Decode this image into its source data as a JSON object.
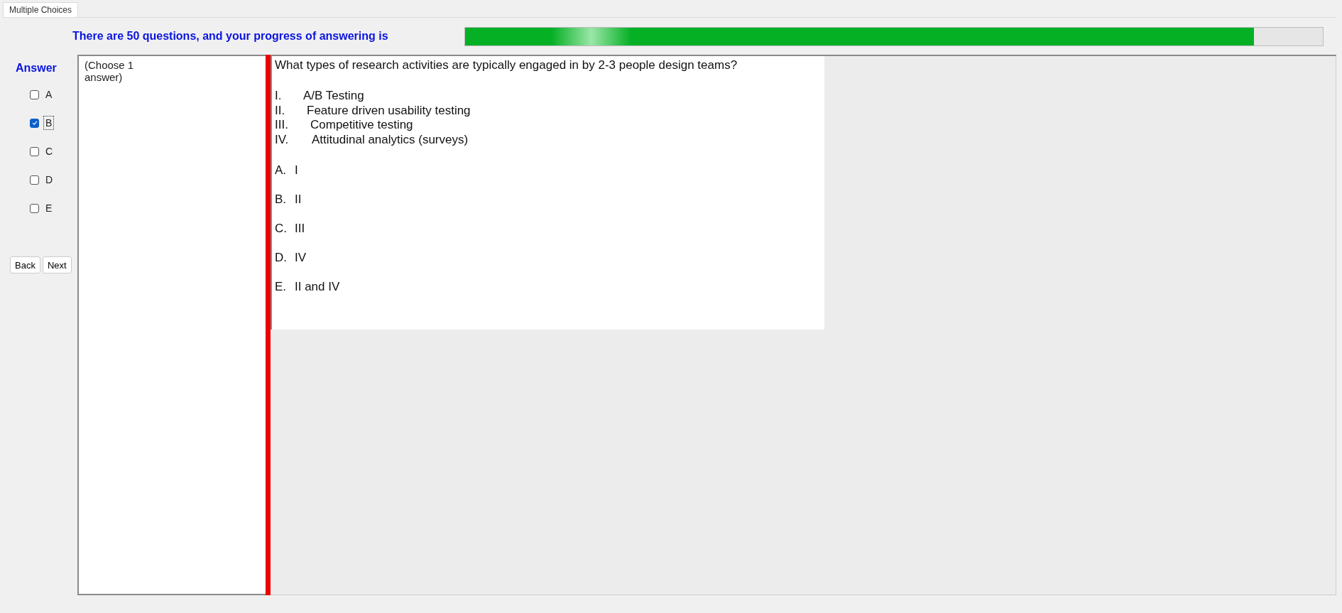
{
  "tab": {
    "label": "Multiple Choices",
    "selected": true
  },
  "progress": {
    "label": "There are 50 questions, and your progress of answering is",
    "level": 0.92
  },
  "answer": {
    "title": "Answer",
    "choices": [
      {
        "label": "A",
        "checked": false,
        "focused": false
      },
      {
        "label": "B",
        "checked": true,
        "focused": true
      },
      {
        "label": "C",
        "checked": false,
        "focused": false
      },
      {
        "label": "D",
        "checked": false,
        "focused": false
      },
      {
        "label": "E",
        "checked": false,
        "focused": false
      }
    ]
  },
  "buttons": [
    "Back",
    "Next"
  ],
  "instruction": [
    "(Choose 1",
    "answer)"
  ],
  "question": {
    "text": "What types of research activities are typically engaged in by 2-3 people design teams?",
    "statements": [
      {
        "numeral": "I.",
        "text": "A/B Testing"
      },
      {
        "numeral": "II.",
        "text": "Feature driven usability testing"
      },
      {
        "numeral": "III.",
        "text": "Competitive testing"
      },
      {
        "numeral": "IV.",
        "text": "Attitudinal analytics (surveys)"
      }
    ],
    "options": [
      {
        "letter": "A.",
        "text": "I"
      },
      {
        "letter": "B.",
        "text": "II"
      },
      {
        "letter": "C.",
        "text": "III"
      },
      {
        "letter": "D.",
        "text": "IV"
      },
      {
        "letter": "E.",
        "text": "II and IV"
      }
    ]
  }
}
